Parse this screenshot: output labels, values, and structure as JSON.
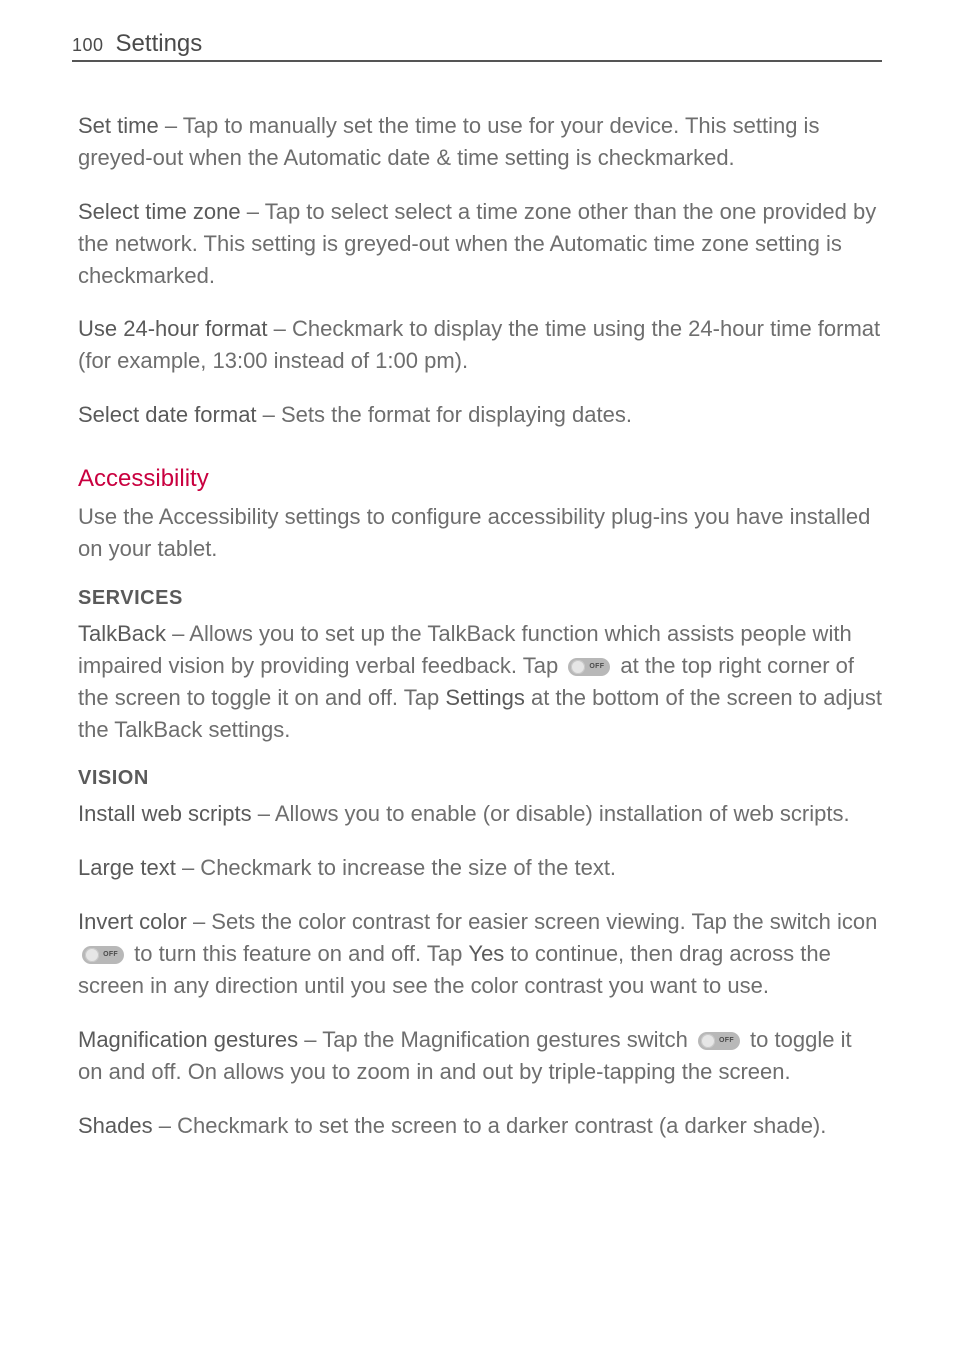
{
  "header": {
    "page_number": "100",
    "title": "Settings"
  },
  "body": {
    "set_time_term": "Set time",
    "set_time_desc": " – Tap to manually set the time to use for your device. This setting is greyed-out when the Automatic date & time setting is checkmarked.",
    "select_tz_term": "Select time zone",
    "select_tz_desc": " – Tap to select select a time zone other than the one provided by the network. This setting is greyed-out when the Automatic time zone setting is checkmarked.",
    "use_24_term": "Use 24-hour format",
    "use_24_desc": " – Checkmark to display the time using the 24-hour time format (for example, 13:00 instead of 1:00 pm).",
    "select_df_term": "Select date format",
    "select_df_desc": " – Sets the format for displaying dates.",
    "accessibility_heading": "Accessibility",
    "accessibility_desc": "Use the Accessibility settings to configure accessibility plug-ins you have installed on your tablet.",
    "services_heading": "SERVICES",
    "talkback_term": "TalkBack",
    "talkback_desc_a": " – Allows you to set up the TalkBack function which assists people with impaired vision by providing verbal feedback. Tap ",
    "talkback_desc_b": " at the top right corner of the screen to toggle it on and off. Tap ",
    "talkback_settings": "Settings",
    "talkback_desc_c": " at the bottom of the screen to adjust the TalkBack settings.",
    "vision_heading": "VISION",
    "install_ws_term": "Install web scripts",
    "install_ws_desc": " – Allows you to enable (or disable) installation of web scripts.",
    "large_text_term": "Large text",
    "large_text_desc": " – Checkmark to increase the size of the text.",
    "invert_term": "Invert color",
    "invert_desc_a": " – Sets the color contrast for easier screen viewing. Tap the switch icon ",
    "invert_desc_b": " to turn this feature on and off. Tap ",
    "invert_yes": "Yes",
    "invert_desc_c": " to continue, then drag across the screen in any direction until you see the color contrast you want to use.",
    "magnify_term": "Magnification gestures",
    "magnify_desc_a": " – Tap the Magnification gestures switch ",
    "magnify_desc_b": " to toggle it on and off. On allows you to zoom in and out by triple-tapping the screen.",
    "shades_term": "Shades",
    "shades_desc": " – Checkmark to set the screen to a darker contrast (a darker shade).",
    "switch_off_label": "OFF"
  }
}
